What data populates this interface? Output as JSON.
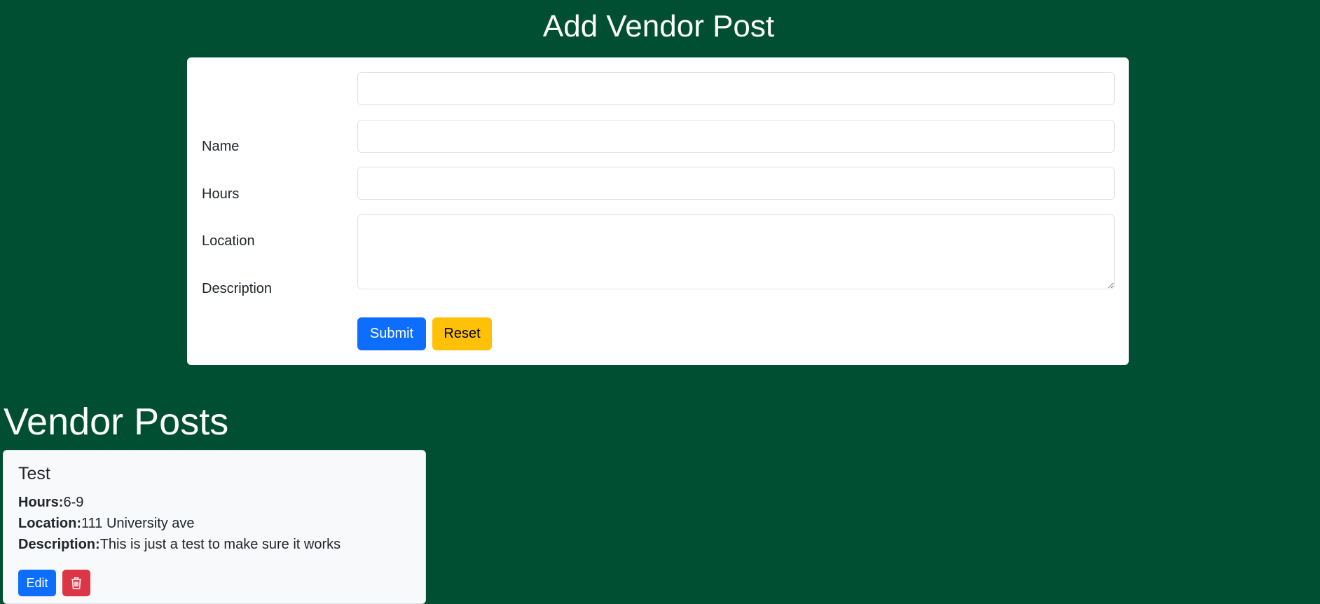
{
  "header": {
    "title": "Add Vendor Post"
  },
  "form": {
    "name": {
      "label": "Name",
      "value": ""
    },
    "hours": {
      "label": "Hours",
      "value": ""
    },
    "location": {
      "label": "Location",
      "value": ""
    },
    "description": {
      "label": "Description",
      "value": ""
    },
    "submit_label": "Submit",
    "reset_label": "Reset"
  },
  "posts_section": {
    "title": "Vendor Posts",
    "posts": [
      {
        "title": "Test",
        "hours_label": "Hours:",
        "hours": "6-9",
        "location_label": "Location:",
        "location": "111 University ave",
        "description_label": "Description:",
        "description": "This is just a test to make sure it works",
        "edit_label": "Edit",
        "delete_icon": "trash-icon"
      }
    ]
  },
  "colors": {
    "background": "#004f32",
    "primary": "#0d6efd",
    "warning": "#ffc107",
    "danger": "#dc3545"
  }
}
